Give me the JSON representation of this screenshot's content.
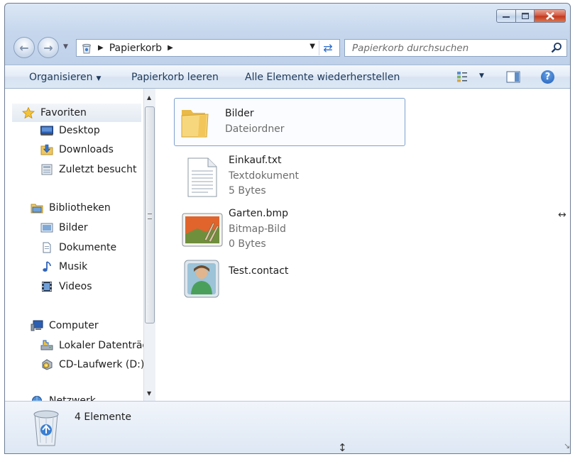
{
  "window": {
    "caption_buttons": {
      "minimize": "minimize-icon",
      "maximize": "maximize-icon",
      "close": "close-icon"
    }
  },
  "address": {
    "crumbs": [
      "Papierkorb"
    ],
    "search_placeholder": "Papierkorb durchsuchen"
  },
  "toolbar": {
    "organize_label": "Organisieren",
    "empty_label": "Papierkorb leeren",
    "restore_label": "Alle Elemente wiederherstellen"
  },
  "navigation": {
    "favorites": {
      "label": "Favoriten",
      "items": [
        "Desktop",
        "Downloads",
        "Zuletzt besucht"
      ]
    },
    "libraries": {
      "label": "Bibliotheken",
      "items": [
        "Bilder",
        "Dokumente",
        "Musik",
        "Videos"
      ]
    },
    "computer": {
      "label": "Computer",
      "items": [
        "Lokaler Datenträg",
        "CD-Laufwerk (D:)"
      ]
    },
    "network": {
      "label": "Netzwerk"
    }
  },
  "files": [
    {
      "name": "Bilder",
      "type": "Dateiordner",
      "size": "",
      "icon": "folder-icon"
    },
    {
      "name": "Einkauf.txt",
      "type": "Textdokument",
      "size": "5 Bytes",
      "icon": "text-file-icon"
    },
    {
      "name": "Garten.bmp",
      "type": "Bitmap-Bild",
      "size": "0 Bytes",
      "icon": "bitmap-file-icon"
    },
    {
      "name": "Test.contact",
      "type": "",
      "size": "",
      "icon": "contact-file-icon"
    }
  ],
  "details": {
    "count_label": "4 Elemente"
  },
  "colors": {
    "accent": "#2a6bc8",
    "selection_border": "#7da2ce",
    "toolbar_text": "#1e395b",
    "close_red": "#c2351a"
  }
}
